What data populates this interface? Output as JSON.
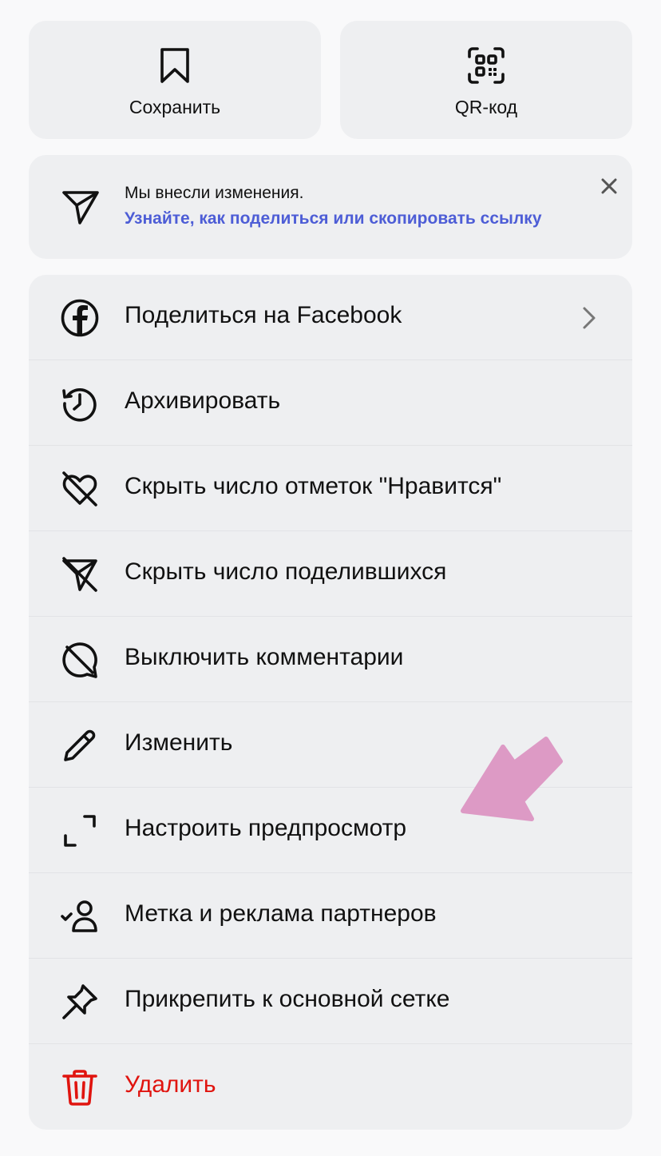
{
  "top_buttons": {
    "save_label": "Сохранить",
    "qr_label": "QR-код"
  },
  "notice": {
    "title": "Мы внесли изменения.",
    "link": "Узнайте, как поделиться или скопировать ссылку"
  },
  "menu": {
    "items": [
      {
        "label": "Поделиться на Facebook",
        "icon": "facebook-icon"
      },
      {
        "label": "Архивировать",
        "icon": "archive-history-icon"
      },
      {
        "label": "Скрыть число отметок \"Нравится\"",
        "icon": "heart-off-icon"
      },
      {
        "label": "Скрыть число поделившихся",
        "icon": "send-off-icon"
      },
      {
        "label": "Выключить комментарии",
        "icon": "comment-off-icon"
      },
      {
        "label": "Изменить",
        "icon": "pencil-icon"
      },
      {
        "label": "Настроить предпросмотр",
        "icon": "crop-corners-icon"
      },
      {
        "label": "Метка и реклама партнеров",
        "icon": "person-check-icon"
      },
      {
        "label": "Прикрепить к основной сетке",
        "icon": "pin-icon"
      },
      {
        "label": "Удалить",
        "icon": "trash-icon"
      }
    ]
  },
  "colors": {
    "link": "#4d5dd6",
    "danger": "#e0140f",
    "card": "#eeeff1",
    "annotation_arrow": "#dd9ac5"
  }
}
